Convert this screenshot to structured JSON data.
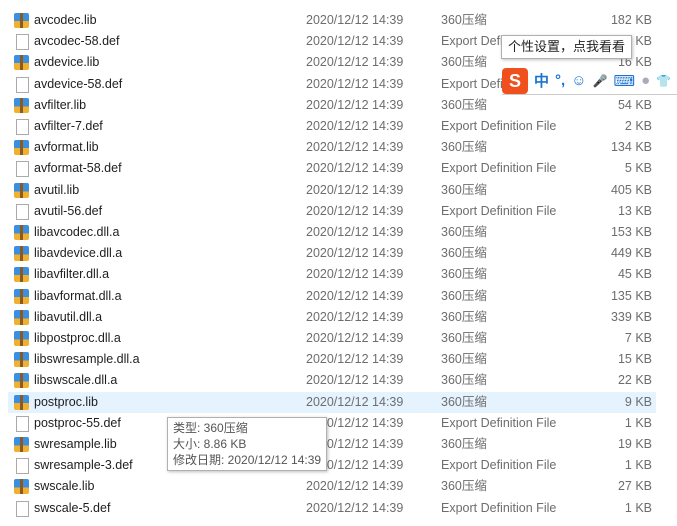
{
  "files": [
    {
      "name": "avcodec.lib",
      "date": "2020/12/12 14:39",
      "type": "360压缩",
      "size": "182 KB",
      "icon": "archive"
    },
    {
      "name": "avcodec-58.def",
      "date": "2020/12/12 14:39",
      "type": "Export Definition File",
      "size": "7 KB",
      "icon": "file"
    },
    {
      "name": "avdevice.lib",
      "date": "2020/12/12 14:39",
      "type": "360压缩",
      "size": "16 KB",
      "icon": "archive"
    },
    {
      "name": "avdevice-58.def",
      "date": "2020/12/12 14:39",
      "type": "Export Definition File",
      "size": "",
      "icon": "file"
    },
    {
      "name": "avfilter.lib",
      "date": "2020/12/12 14:39",
      "type": "360压缩",
      "size": "54 KB",
      "icon": "archive"
    },
    {
      "name": "avfilter-7.def",
      "date": "2020/12/12 14:39",
      "type": "Export Definition File",
      "size": "2 KB",
      "icon": "file"
    },
    {
      "name": "avformat.lib",
      "date": "2020/12/12 14:39",
      "type": "360压缩",
      "size": "134 KB",
      "icon": "archive"
    },
    {
      "name": "avformat-58.def",
      "date": "2020/12/12 14:39",
      "type": "Export Definition File",
      "size": "5 KB",
      "icon": "file"
    },
    {
      "name": "avutil.lib",
      "date": "2020/12/12 14:39",
      "type": "360压缩",
      "size": "405 KB",
      "icon": "archive"
    },
    {
      "name": "avutil-56.def",
      "date": "2020/12/12 14:39",
      "type": "Export Definition File",
      "size": "13 KB",
      "icon": "file"
    },
    {
      "name": "libavcodec.dll.a",
      "date": "2020/12/12 14:39",
      "type": "360压缩",
      "size": "153 KB",
      "icon": "archive"
    },
    {
      "name": "libavdevice.dll.a",
      "date": "2020/12/12 14:39",
      "type": "360压缩",
      "size": "449 KB",
      "icon": "archive"
    },
    {
      "name": "libavfilter.dll.a",
      "date": "2020/12/12 14:39",
      "type": "360压缩",
      "size": "45 KB",
      "icon": "archive"
    },
    {
      "name": "libavformat.dll.a",
      "date": "2020/12/12 14:39",
      "type": "360压缩",
      "size": "135 KB",
      "icon": "archive"
    },
    {
      "name": "libavutil.dll.a",
      "date": "2020/12/12 14:39",
      "type": "360压缩",
      "size": "339 KB",
      "icon": "archive"
    },
    {
      "name": "libpostproc.dll.a",
      "date": "2020/12/12 14:39",
      "type": "360压缩",
      "size": "7 KB",
      "icon": "archive"
    },
    {
      "name": "libswresample.dll.a",
      "date": "2020/12/12 14:39",
      "type": "360压缩",
      "size": "15 KB",
      "icon": "archive"
    },
    {
      "name": "libswscale.dll.a",
      "date": "2020/12/12 14:39",
      "type": "360压缩",
      "size": "22 KB",
      "icon": "archive"
    },
    {
      "name": "postproc.lib",
      "date": "2020/12/12 14:39",
      "type": "360压缩",
      "size": "9 KB",
      "icon": "archive",
      "selected": true
    },
    {
      "name": "postproc-55.def",
      "date": "2020/12/12 14:39",
      "type": "Export Definition File",
      "size": "1 KB",
      "icon": "file"
    },
    {
      "name": "swresample.lib",
      "date": "2020/12/12 14:39",
      "type": "360压缩",
      "size": "19 KB",
      "icon": "archive"
    },
    {
      "name": "swresample-3.def",
      "date": "2020/12/12 14:39",
      "type": "Export Definition File",
      "size": "1 KB",
      "icon": "file"
    },
    {
      "name": "swscale.lib",
      "date": "2020/12/12 14:39",
      "type": "360压缩",
      "size": "27 KB",
      "icon": "archive"
    },
    {
      "name": "swscale-5.def",
      "date": "2020/12/12 14:39",
      "type": "Export Definition File",
      "size": "1 KB",
      "icon": "file"
    }
  ],
  "file_tooltip": {
    "type": "类型: 360压缩",
    "size": "大小: 8.86 KB",
    "modified": "修改日期: 2020/12/12 14:39"
  },
  "ime": {
    "tooltip": "个性设置，点我看看",
    "logo": "S",
    "mode": "中",
    "punct": "°,",
    "emoji": "☺",
    "mic": "🎤",
    "keyboard": "⌨",
    "skin": "👕"
  }
}
